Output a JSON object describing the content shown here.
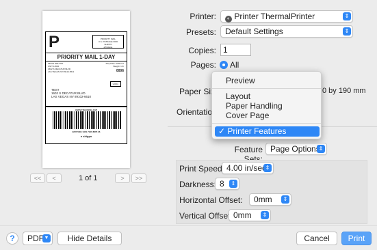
{
  "label": {
    "big_letter": "P",
    "postage_lines": [
      "PRIORITY MAIL",
      "U.S. POSTAGE PAID",
      "SHIPPO",
      "ePostage"
    ],
    "service_title": "PRIORITY MAIL 1-DAY",
    "from_lines": [
      "KEVIN WALTON",
      "UNIT 14602",
      "1602 S DECATUR BLVD",
      "LAS VEGAS NV 89114-9511"
    ],
    "ship_date": "Ship Date: 03/01/17",
    "weight": "Weight: 1 lb",
    "zip_code": "0006",
    "route_code": "C001",
    "to_lines": [
      "TEST",
      "1602 S DECATUR BLVD",
      "LAS VEGAS NV 89102-6610"
    ],
    "tracking_label": "USPS TRACKING # EP",
    "tracking_number": "9205 5901 9461 7246 8878 26",
    "brand": "shippo"
  },
  "pager": {
    "first": "<<",
    "prev": "<",
    "indicator": "1 of 1",
    "next": ">",
    "last": ">>"
  },
  "form": {
    "printer_label": "Printer:",
    "printer_value": "Printer ThermalPrinter",
    "presets_label": "Presets:",
    "presets_value": "Default Settings",
    "copies_label": "Copies:",
    "copies_value": "1",
    "pages_label": "Pages:",
    "pages_all": "All",
    "paper_size_label": "Paper Size",
    "paper_size_value": "0 by 190 mm",
    "orientation_label": "Orientation"
  },
  "menu": {
    "items": [
      "Preview",
      "Layout",
      "Paper Handling",
      "Cover Page",
      "Printer Features"
    ],
    "selected_check": "✓"
  },
  "feature_sets": {
    "label": "Feature Sets:",
    "value": "Page Options"
  },
  "options": {
    "print_speed_label": "Print Speed:",
    "print_speed_value": "4.00 in/sec",
    "darkness_label": "Darkness:",
    "darkness_value": "8",
    "hoffset_label": "Horizontal Offset:",
    "hoffset_value": "0mm",
    "voffset_label": "Vertical Offset:",
    "voffset_value": "0mm"
  },
  "bottom": {
    "help": "?",
    "pdf": "PDF",
    "hide_details": "Hide Details",
    "cancel": "Cancel",
    "print": "Print"
  },
  "colors": {
    "accent": "#2e87f6",
    "window_bg": "#ececec"
  }
}
